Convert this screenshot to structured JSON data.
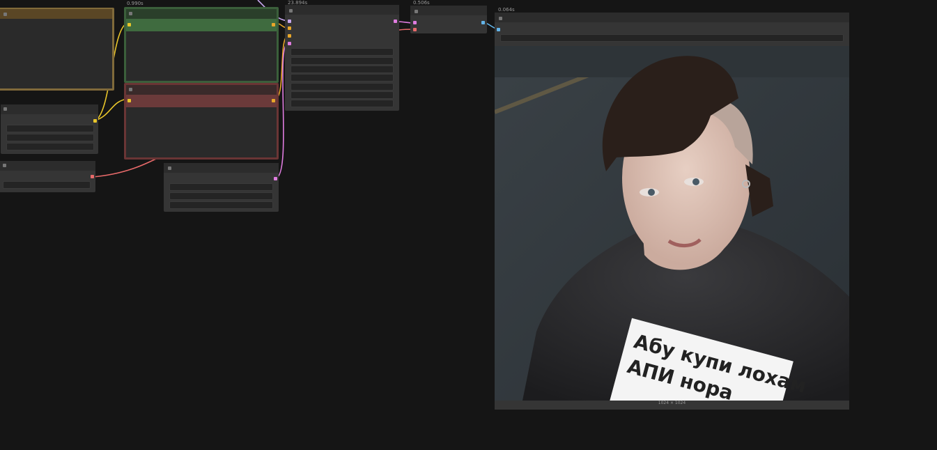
{
  "canvas": {
    "background": "#151515"
  },
  "timings": {
    "clip_positive": "0.990s",
    "ksampler": "23.894s",
    "vae_decode": "0.506s",
    "save_image": "0.064s"
  },
  "preview": {
    "size_label": "1024 × 1024",
    "tshirt_text": [
      "Абу купи лохам",
      "АПИ нора"
    ]
  },
  "colors": {
    "group_brown": "#806a3a",
    "group_green": "#3b5f3b",
    "group_red": "#6a3535",
    "wire_yellow": "#e8c52a",
    "wire_pink": "#e07ce0",
    "wire_red": "#e86a6a",
    "wire_blue": "#64b4e8"
  }
}
